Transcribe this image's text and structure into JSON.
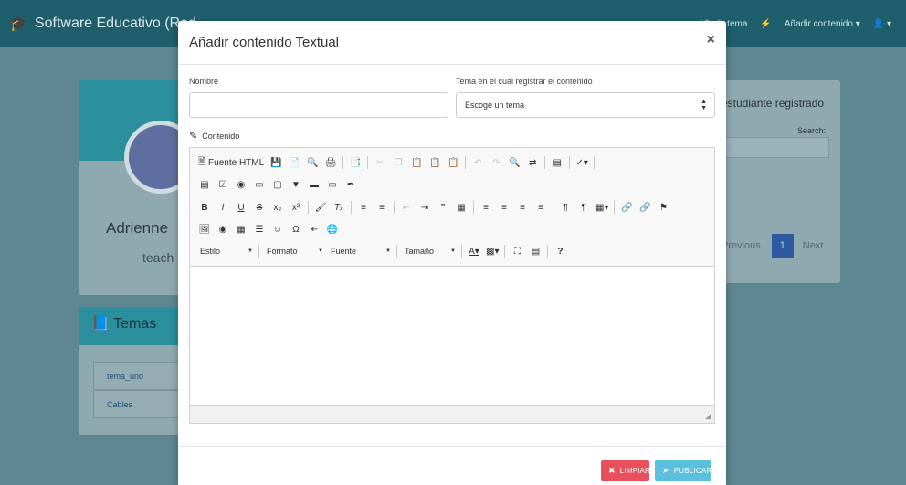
{
  "navbar": {
    "brand": "Software Educativo (Red",
    "items": [
      "Añadir tema",
      "Añadir contenido"
    ]
  },
  "background": {
    "profile_name": "Adrienne",
    "profile_role": "teach",
    "temas_title": "Temas",
    "temas_items": [
      "tema_uno",
      "Cables"
    ],
    "estudiantes_title": "estudiante registrado",
    "search_label": "Search:",
    "pagination": {
      "previous": "Previous",
      "current": "1",
      "next": "Next"
    }
  },
  "modal": {
    "title": "Añadir contenido Textual",
    "close": "×",
    "nombre_label": "Nombre",
    "tema_label": "Tema en el cual registrar el contenido",
    "tema_selected": "Escoge un tema",
    "contenido_label": "Contenido",
    "editor": {
      "source_label": "Fuente HTML",
      "combos": [
        "Estilo",
        "Formato",
        "Fuente",
        "Tamaño"
      ],
      "help": "?"
    },
    "buttons": {
      "limpiar": "LIMPIAR",
      "publicar": "PUBLICAR"
    }
  },
  "colors": {
    "accent": "#2b8f9d",
    "navbar": "#1f5f6b",
    "danger": "#e8505b",
    "info": "#5bc0de"
  }
}
